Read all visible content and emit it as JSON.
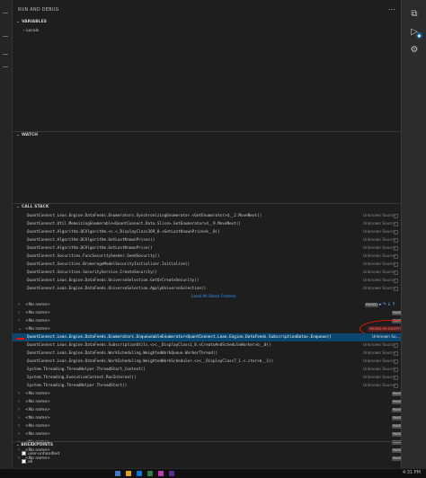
{
  "panel": {
    "title": "RUN AND DEBUG",
    "more_icon": "ellipsis-icon"
  },
  "variables": {
    "header": "VARIABLES",
    "scope_label": "Locals"
  },
  "watch": {
    "header": "WATCH"
  },
  "call_stack": {
    "header": "CALL STACK",
    "frames_top": [
      {
        "text": "QuantConnect.Lean.Engine.DataFeeds.Enumerators.SynchronizingEnumerator.<GetEnumerator>d__2.MoveNext()",
        "source": "Unknown Source"
      },
      {
        "text": "QuantConnect.Util.MemoizingEnumerable<QuantConnect.Data.Slice>.GetEnumerator>d__9.MoveNext()",
        "source": "Unknown Source"
      },
      {
        "text": "QuantConnect.Algorithm.QCAlgorithm.<c.<_DisplayClass369_0.<GetLastKnownPrice>b__0()",
        "source": "Unknown Source"
      },
      {
        "text": "QuantConnect.Algorithm.QCAlgorithm.GetLastKnownPrices()",
        "source": "Unknown Source"
      },
      {
        "text": "QuantConnect.Algorithm.QCAlgorithm.GetLastKnownPrice()",
        "source": "Unknown Source"
      },
      {
        "text": "QuantConnect.Securities.FuncSecuritySeeder.SeedSecurity()",
        "source": "Unknown Source"
      },
      {
        "text": "QuantConnect.Securities.BrokerageModelSecurityInitializer.Initialize()",
        "source": "Unknown Source"
      },
      {
        "text": "QuantConnect.Securities.SecurityService.CreateSecurity()",
        "source": "Unknown Source"
      },
      {
        "text": "QuantConnect.Lean.Engine.DataFeeds.UniverseSelection.GetOrCreateSecurity()",
        "source": "Unknown Source"
      },
      {
        "text": "QuantConnect.Lean.Engine.DataFeeds.UniverseSelection.ApplyUniverseSelection()",
        "source": "Unknown Source"
      }
    ],
    "load_all": "Load All Stack Frames",
    "thread_paused_1": {
      "name": "<No name>",
      "status": "PAUSED"
    },
    "thread_plain_1": {
      "name": "<No name>",
      "status": "PAUSED"
    },
    "thread_plain_2": {
      "name": "<No name>",
      "status": "PAUSED"
    },
    "exception_thread": {
      "name": "<No name>",
      "status": "PAUSED ON EXCEPTION"
    },
    "current_frame": {
      "text": "QuantConnect.Lean.Engine.DataFeeds.Enumerators.EnqueueableEnumerator<QuantConnect.Lean.Engine.DataFeeds.SubscriptionData>.Enqueue()",
      "source": "Unknown So..."
    },
    "frames_bottom": [
      {
        "text": "QuantConnect.Lean.Engine.DataFeeds.SubscriptionUtils.<>c__DisplayClass1_0.<CreateAndScheduleWorker>b__0()",
        "source": "Unknown Source"
      },
      {
        "text": "QuantConnect.Lean.Engine.DataFeeds.WorkScheduling.WeightedWorkQueue.WorkerThread()",
        "source": "Unknown Source"
      },
      {
        "text": "QuantConnect.Lean.Engine.DataFeeds.WorkScheduling.WeightedWorkScheduler.<>c__DisplayClass7_1.<.ctor>b__1()",
        "source": "Unknown Source"
      },
      {
        "text": "System.Threading.ThreadHelper.ThreadStart_Context()",
        "source": "Unknown Source"
      },
      {
        "text": "System.Threading.ExecutionContext.RunInternal()",
        "source": "Unknown Source"
      },
      {
        "text": "System.Threading.ThreadHelper.ThreadStart()",
        "source": "Unknown Source"
      }
    ],
    "threads_bottom": [
      {
        "name": "<No name>",
        "status": "PAUSED"
      },
      {
        "name": "<No name>",
        "status": "PAUSED"
      },
      {
        "name": "<No name>",
        "status": "PAUSED"
      },
      {
        "name": "<No name>",
        "status": "PAUSED"
      },
      {
        "name": "<No name>",
        "status": "PAUSED"
      },
      {
        "name": "<No name>",
        "status": "PAUSED"
      },
      {
        "name": "<No name>",
        "status": "PAUSED"
      },
      {
        "name": "<No name>",
        "status": "PAUSED"
      },
      {
        "name": "<No name>",
        "status": "PAUSED"
      }
    ]
  },
  "breakpoints": {
    "header": "BREAKPOINTS",
    "items": [
      {
        "label": "user-unhandled"
      },
      {
        "label": "all"
      }
    ]
  },
  "taskbar": {
    "clock": "4:31 PM"
  },
  "icons": {
    "activity_top": "copy-icon",
    "activity_debug": "run-debug-icon",
    "activity_settings": "gear-icon"
  },
  "colors": {
    "accent": "#3794ff",
    "selection": "#094771",
    "exception": "#f48771",
    "annotation_red": "#e51400"
  }
}
